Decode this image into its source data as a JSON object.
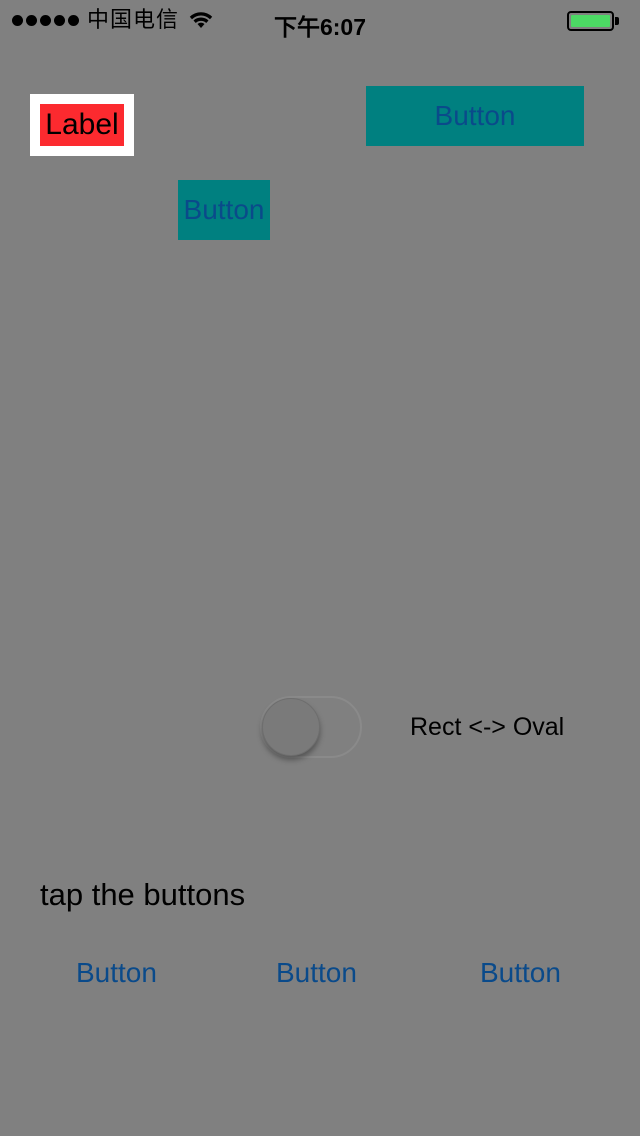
{
  "status_bar": {
    "carrier": "中国电信",
    "time": "下午6:07",
    "signal_bars": 5,
    "battery_color": "#4cd964",
    "wifi_icon": "wifi-icon",
    "battery_level": 1.0
  },
  "main": {
    "label_text": "Label",
    "top_button_label": "Button",
    "second_button_label": "Button",
    "switch": {
      "label": "Rect <-> Oval",
      "on": false
    },
    "hint_text": "tap the buttons",
    "bottom_buttons": [
      "Button",
      "Button",
      "Button"
    ]
  },
  "colors": {
    "background": "#808080",
    "label_fill": "#fc2a2f",
    "teal": "#008080",
    "link_text": "#0a4a8a"
  }
}
